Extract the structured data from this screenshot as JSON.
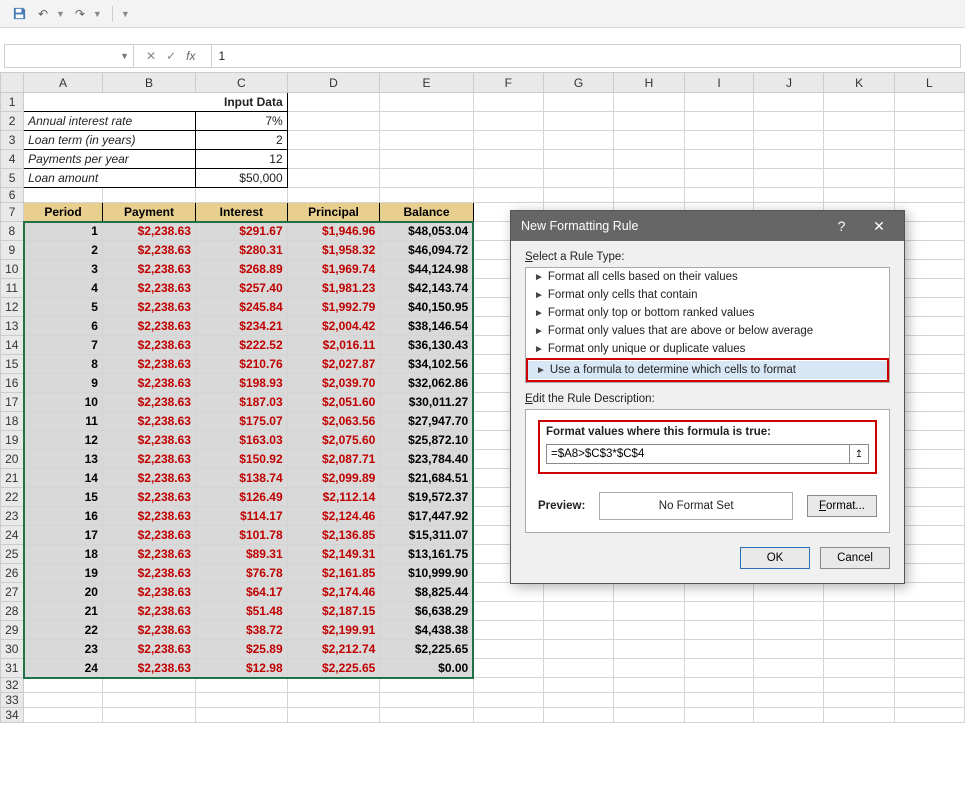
{
  "toolbar": {
    "save_icon": "💾",
    "undo_icon": "↶",
    "redo_icon": "↷"
  },
  "formula_bar": {
    "name_box": "",
    "fx_label": "fx",
    "value": "1"
  },
  "columns": [
    "A",
    "B",
    "C",
    "D",
    "E",
    "F",
    "G",
    "H",
    "I",
    "J",
    "K",
    "L"
  ],
  "input_section": {
    "title": "Input Data",
    "rows": [
      {
        "label": "Annual interest rate",
        "value": "7%"
      },
      {
        "label": "Loan term (in years)",
        "value": "2"
      },
      {
        "label": "Payments per year",
        "value": "12"
      },
      {
        "label": "Loan amount",
        "value": "$50,000"
      }
    ]
  },
  "table": {
    "headers": [
      "Period",
      "Payment",
      "Interest",
      "Principal",
      "Balance"
    ],
    "rows": [
      {
        "period": "1",
        "payment": "$2,238.63",
        "interest": "$291.67",
        "principal": "$1,946.96",
        "balance": "$48,053.04"
      },
      {
        "period": "2",
        "payment": "$2,238.63",
        "interest": "$280.31",
        "principal": "$1,958.32",
        "balance": "$46,094.72"
      },
      {
        "period": "3",
        "payment": "$2,238.63",
        "interest": "$268.89",
        "principal": "$1,969.74",
        "balance": "$44,124.98"
      },
      {
        "period": "4",
        "payment": "$2,238.63",
        "interest": "$257.40",
        "principal": "$1,981.23",
        "balance": "$42,143.74"
      },
      {
        "period": "5",
        "payment": "$2,238.63",
        "interest": "$245.84",
        "principal": "$1,992.79",
        "balance": "$40,150.95"
      },
      {
        "period": "6",
        "payment": "$2,238.63",
        "interest": "$234.21",
        "principal": "$2,004.42",
        "balance": "$38,146.54"
      },
      {
        "period": "7",
        "payment": "$2,238.63",
        "interest": "$222.52",
        "principal": "$2,016.11",
        "balance": "$36,130.43"
      },
      {
        "period": "8",
        "payment": "$2,238.63",
        "interest": "$210.76",
        "principal": "$2,027.87",
        "balance": "$34,102.56"
      },
      {
        "period": "9",
        "payment": "$2,238.63",
        "interest": "$198.93",
        "principal": "$2,039.70",
        "balance": "$32,062.86"
      },
      {
        "period": "10",
        "payment": "$2,238.63",
        "interest": "$187.03",
        "principal": "$2,051.60",
        "balance": "$30,011.27"
      },
      {
        "period": "11",
        "payment": "$2,238.63",
        "interest": "$175.07",
        "principal": "$2,063.56",
        "balance": "$27,947.70"
      },
      {
        "period": "12",
        "payment": "$2,238.63",
        "interest": "$163.03",
        "principal": "$2,075.60",
        "balance": "$25,872.10"
      },
      {
        "period": "13",
        "payment": "$2,238.63",
        "interest": "$150.92",
        "principal": "$2,087.71",
        "balance": "$23,784.40"
      },
      {
        "period": "14",
        "payment": "$2,238.63",
        "interest": "$138.74",
        "principal": "$2,099.89",
        "balance": "$21,684.51"
      },
      {
        "period": "15",
        "payment": "$2,238.63",
        "interest": "$126.49",
        "principal": "$2,112.14",
        "balance": "$19,572.37"
      },
      {
        "period": "16",
        "payment": "$2,238.63",
        "interest": "$114.17",
        "principal": "$2,124.46",
        "balance": "$17,447.92"
      },
      {
        "period": "17",
        "payment": "$2,238.63",
        "interest": "$101.78",
        "principal": "$2,136.85",
        "balance": "$15,311.07"
      },
      {
        "period": "18",
        "payment": "$2,238.63",
        "interest": "$89.31",
        "principal": "$2,149.31",
        "balance": "$13,161.75"
      },
      {
        "period": "19",
        "payment": "$2,238.63",
        "interest": "$76.78",
        "principal": "$2,161.85",
        "balance": "$10,999.90"
      },
      {
        "period": "20",
        "payment": "$2,238.63",
        "interest": "$64.17",
        "principal": "$2,174.46",
        "balance": "$8,825.44"
      },
      {
        "period": "21",
        "payment": "$2,238.63",
        "interest": "$51.48",
        "principal": "$2,187.15",
        "balance": "$6,638.29"
      },
      {
        "period": "22",
        "payment": "$2,238.63",
        "interest": "$38.72",
        "principal": "$2,199.91",
        "balance": "$4,438.38"
      },
      {
        "period": "23",
        "payment": "$2,238.63",
        "interest": "$25.89",
        "principal": "$2,212.74",
        "balance": "$2,225.65"
      },
      {
        "period": "24",
        "payment": "$2,238.63",
        "interest": "$12.98",
        "principal": "$2,225.65",
        "balance": "$0.00"
      }
    ]
  },
  "dialog": {
    "title": "New Formatting Rule",
    "select_rule_label": "Select a Rule Type:",
    "rule_types": [
      "Format all cells based on their values",
      "Format only cells that contain",
      "Format only top or bottom ranked values",
      "Format only values that are above or below average",
      "Format only unique or duplicate values",
      "Use a formula to determine which cells to format"
    ],
    "edit_desc_label": "Edit the Rule Description:",
    "formula_label": "Format values where this formula is true:",
    "formula_value": "=$A8>$C$3*$C$4",
    "preview_label": "Preview:",
    "preview_text": "No Format Set",
    "format_btn": "Format...",
    "ok": "OK",
    "cancel": "Cancel"
  }
}
